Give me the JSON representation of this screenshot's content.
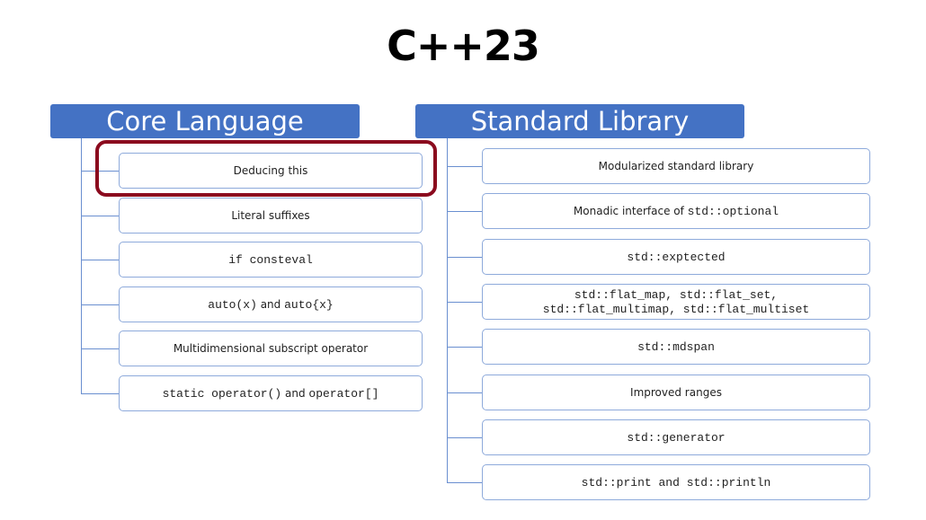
{
  "title": "C++23",
  "core": {
    "header": "Core Language",
    "items": [
      {
        "parts": [
          {
            "t": "Deducing this",
            "s": "sans"
          }
        ]
      },
      {
        "parts": [
          {
            "t": "Literal suffixes",
            "s": "sans"
          }
        ]
      },
      {
        "parts": [
          {
            "t": "if consteval",
            "s": "mono"
          }
        ]
      },
      {
        "parts": [
          {
            "t": "auto(x)",
            "s": "mono"
          },
          {
            "t": " and ",
            "s": "sans"
          },
          {
            "t": "auto{x}",
            "s": "mono"
          }
        ]
      },
      {
        "parts": [
          {
            "t": "Multidimensional subscript operator",
            "s": "sans"
          }
        ]
      },
      {
        "parts": [
          {
            "t": "static operator()",
            "s": "mono"
          },
          {
            "t": " and ",
            "s": "sans"
          },
          {
            "t": "operator[]",
            "s": "mono"
          }
        ]
      }
    ],
    "highlighted_index": 0,
    "highlight_color": "#8b0a1e"
  },
  "std": {
    "header": "Standard Library",
    "items": [
      {
        "parts": [
          {
            "t": "Modularized standard library",
            "s": "sans"
          }
        ]
      },
      {
        "parts": [
          {
            "t": "Monadic interface of ",
            "s": "sans"
          },
          {
            "t": "std::optional",
            "s": "mono"
          }
        ]
      },
      {
        "parts": [
          {
            "t": "std::exptected",
            "s": "mono"
          }
        ]
      },
      {
        "parts": [
          {
            "t": "std::flat_map, std::flat_set,\nstd::flat_multimap, std::flat_multiset",
            "s": "mono"
          }
        ]
      },
      {
        "parts": [
          {
            "t": "std::mdspan",
            "s": "mono"
          }
        ]
      },
      {
        "parts": [
          {
            "t": "Improved ranges",
            "s": "sans"
          }
        ]
      },
      {
        "parts": [
          {
            "t": "std::generator",
            "s": "mono"
          }
        ]
      },
      {
        "parts": [
          {
            "t": "std::print and std::println",
            "s": "mono"
          }
        ]
      }
    ]
  },
  "colors": {
    "header_bg": "#4472c4",
    "box_border": "#8eaadb",
    "connector": "#6a8fd0"
  }
}
